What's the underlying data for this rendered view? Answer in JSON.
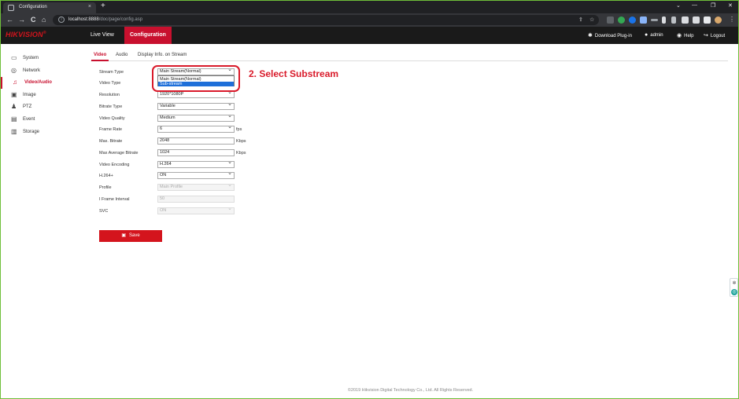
{
  "browser": {
    "tab_title": "Configuration",
    "tab_close": "×",
    "new_tab": "+",
    "url_host": "localhost:8888",
    "url_path": "/doc/page/config.asp",
    "info_icon": "i",
    "window_controls": {
      "minimize": "—",
      "restore": "❐",
      "close": "✕",
      "dropdown": "⌄"
    },
    "nav": {
      "back": "←",
      "forward": "→",
      "reload": "C",
      "home": "⌂"
    }
  },
  "header": {
    "brand": "HIKVISION",
    "brand_mark": "®",
    "nav": [
      {
        "label": "Live View"
      },
      {
        "label": "Configuration"
      }
    ],
    "right": {
      "download_plugin": "Download Plug-in",
      "user": "admin",
      "help": "Help",
      "logout": "Logout"
    }
  },
  "sidebar": {
    "items": [
      {
        "label": "System",
        "icon": "system-icon"
      },
      {
        "label": "Network",
        "icon": "network-icon"
      },
      {
        "label": "Video/Audio",
        "icon": "video-audio-icon"
      },
      {
        "label": "Image",
        "icon": "image-icon"
      },
      {
        "label": "PTZ",
        "icon": "ptz-icon"
      },
      {
        "label": "Event",
        "icon": "event-icon"
      },
      {
        "label": "Storage",
        "icon": "storage-icon"
      }
    ],
    "active_index": 2
  },
  "subtabs": [
    {
      "label": "Video"
    },
    {
      "label": "Audio"
    },
    {
      "label": "Display Info. on Stream"
    }
  ],
  "form": {
    "rows": [
      {
        "label": "Stream Type",
        "value": "Main Stream(Normal)",
        "unit": ""
      },
      {
        "label": "Video Type",
        "value": "",
        "unit": ""
      },
      {
        "label": "Resolution",
        "value": "1920*1080P",
        "unit": ""
      },
      {
        "label": "Bitrate Type",
        "value": "Variable",
        "unit": ""
      },
      {
        "label": "Video Quality",
        "value": "Medium",
        "unit": ""
      },
      {
        "label": "Frame Rate",
        "value": "6",
        "unit": "fps"
      },
      {
        "label": "Max. Bitrate",
        "value": "2048",
        "unit": "Kbps"
      },
      {
        "label": "Max Average Bitrate",
        "value": "1024",
        "unit": "Kbps"
      },
      {
        "label": "Video Encoding",
        "value": "H.264",
        "unit": ""
      },
      {
        "label": "H.264+",
        "value": "ON",
        "unit": ""
      },
      {
        "label": "Profile",
        "value": "Main Profile",
        "unit": ""
      },
      {
        "label": "I Frame Interval",
        "value": "50",
        "unit": ""
      },
      {
        "label": "SVC",
        "value": "ON",
        "unit": ""
      }
    ],
    "stream_type_options": [
      "Main Stream(Normal)",
      "Sub-stream"
    ],
    "save_label": "Save"
  },
  "annotation": {
    "text": "2. Select Substream",
    "color": "#d91a2a"
  },
  "footer": {
    "copyright": "©2019 Hikvision Digital Technology Co., Ltd. All Rights Reserved."
  },
  "colors": {
    "brand_red": "#c8102e",
    "highlight_blue": "#1e6fd9"
  }
}
